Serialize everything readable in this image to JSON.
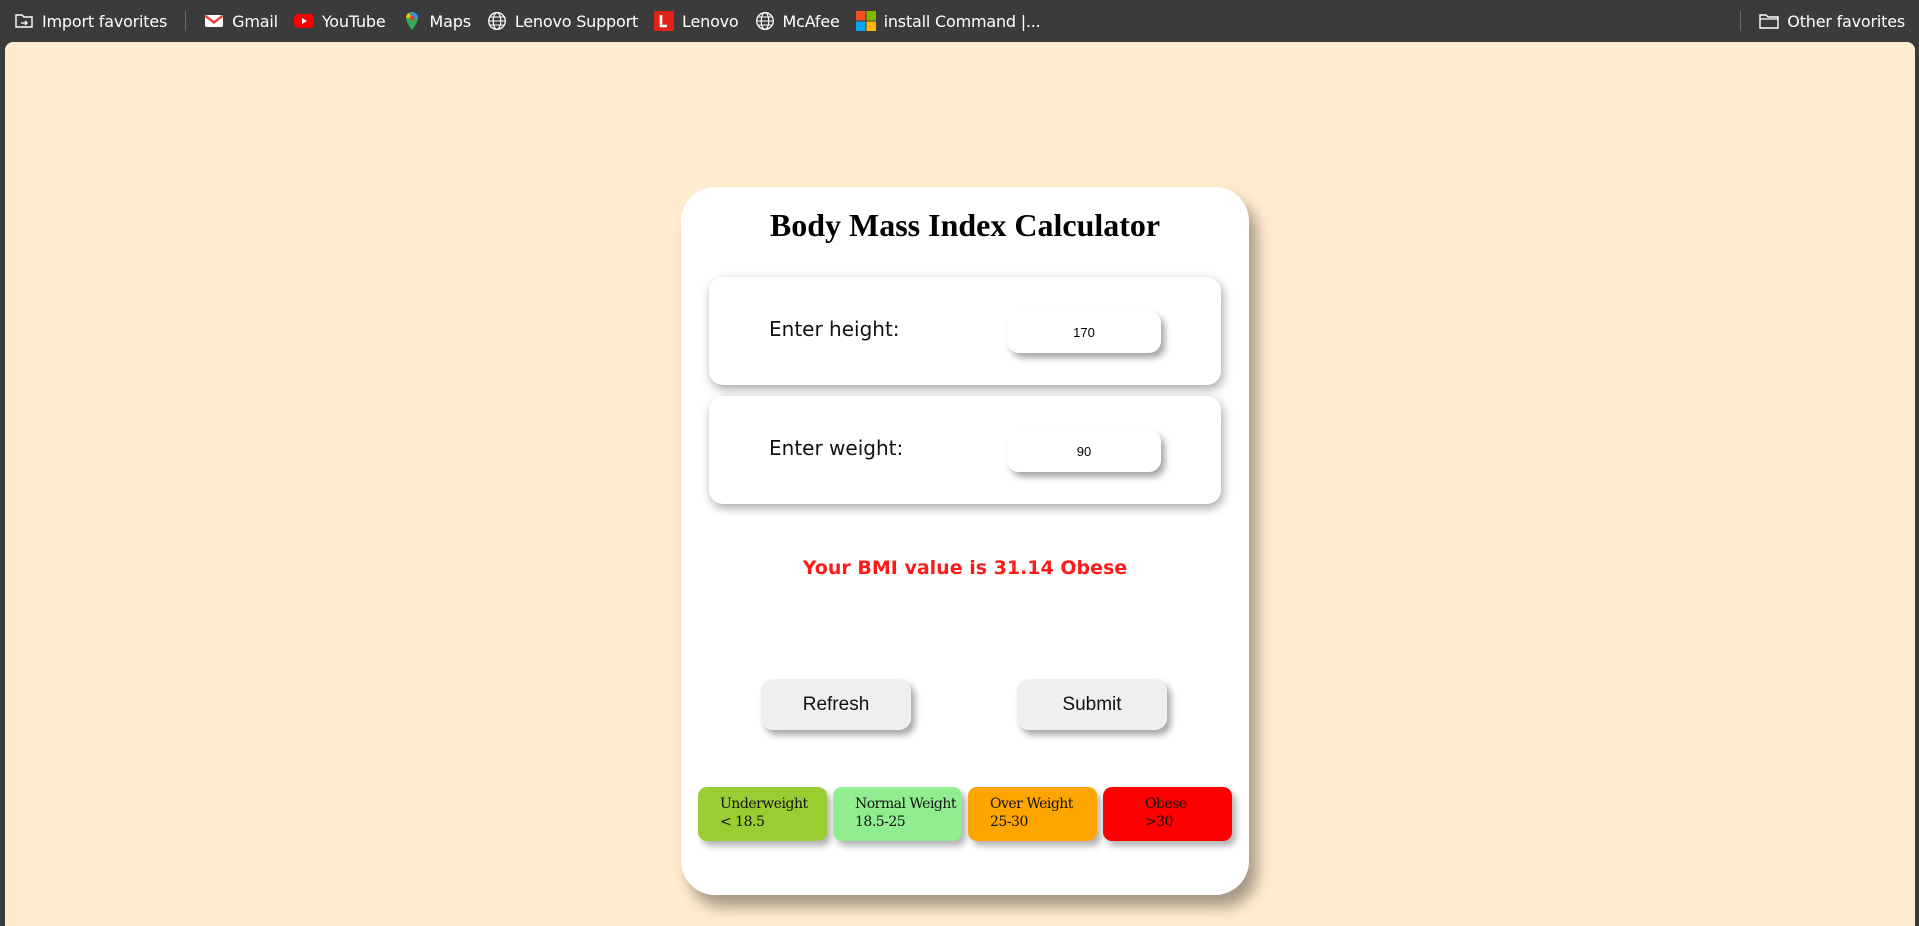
{
  "bookmarks": {
    "items": [
      {
        "label": "Import favorites",
        "icon": "import-favorites-icon"
      },
      {
        "label": "Gmail",
        "icon": "gmail-icon"
      },
      {
        "label": "YouTube",
        "icon": "youtube-icon"
      },
      {
        "label": "Maps",
        "icon": "maps-pin-icon"
      },
      {
        "label": "Lenovo Support",
        "icon": "globe-icon"
      },
      {
        "label": "Lenovo",
        "icon": "lenovo-icon"
      },
      {
        "label": "McAfee",
        "icon": "globe-icon"
      },
      {
        "label": "install Command |...",
        "icon": "microsoft-icon"
      }
    ],
    "other": {
      "label": "Other favorites",
      "icon": "folder-icon"
    }
  },
  "page": {
    "background": "#ffebcd",
    "title": "Body Mass Index Calculator",
    "height": {
      "label": "Enter height:",
      "value": "170"
    },
    "weight": {
      "label": "Enter weight:",
      "value": "90"
    },
    "result": "Your BMI value is 31.14 Obese",
    "result_color": "#ff1a1a",
    "buttons": {
      "refresh": "Refresh",
      "submit": "Submit"
    },
    "legend": [
      {
        "name": "Underweight",
        "range": "< 18.5",
        "color": "#9acd32"
      },
      {
        "name": "Normal Weight",
        "range": "18.5-25",
        "color": "#90ee90"
      },
      {
        "name": "Over Weight",
        "range": "25-30",
        "color": "#ffa500"
      },
      {
        "name": "Obese",
        "range": ">30",
        "color": "#ff0000"
      }
    ]
  }
}
